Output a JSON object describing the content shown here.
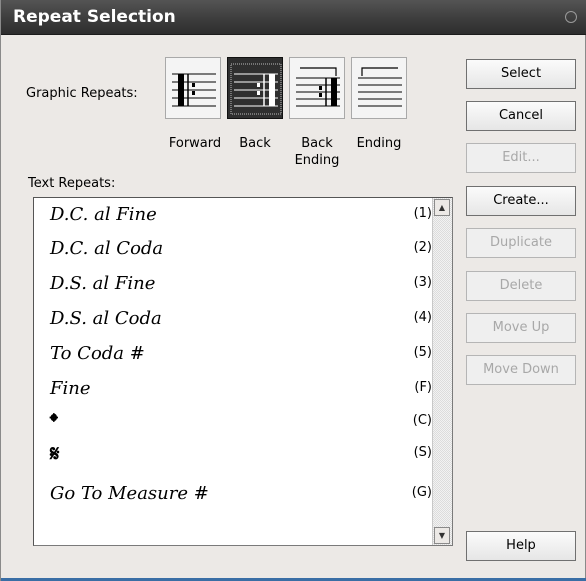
{
  "window": {
    "title": "Repeat Selection"
  },
  "graphic_repeats": {
    "label": "Graphic Repeats:",
    "items": [
      {
        "caption": "Forward",
        "icon": "forward-repeat-barline-icon",
        "selected": false
      },
      {
        "caption": "Back",
        "icon": "back-repeat-barline-icon",
        "selected": true
      },
      {
        "caption": "Back\nEnding",
        "icon": "back-ending-bracket-icon",
        "selected": false
      },
      {
        "caption": "Ending",
        "icon": "ending-bracket-icon",
        "selected": false
      }
    ]
  },
  "text_repeats": {
    "label": "Text Repeats:",
    "items": [
      {
        "text": "D.C. al Fine",
        "key": "(1)"
      },
      {
        "text": "D.C. al Coda",
        "key": "(2)"
      },
      {
        "text": "D.S. al Fine",
        "key": "(3)"
      },
      {
        "text": "D.S. al Coda",
        "key": "(4)"
      },
      {
        "text": "To Coda #",
        "key": "(5)"
      },
      {
        "text": "Fine",
        "key": "(F)"
      },
      {
        "text": "𝄌",
        "key": "(C)",
        "icon": "coda-symbol-icon"
      },
      {
        "text": "𝄋",
        "key": "(S)",
        "icon": "segno-symbol-icon"
      },
      {
        "text": "Go To Measure #",
        "key": "(G)"
      }
    ]
  },
  "buttons": {
    "select": "Select",
    "cancel": "Cancel",
    "edit": "Edit...",
    "create": "Create...",
    "duplicate": "Duplicate",
    "delete": "Delete",
    "move_up": "Move Up",
    "move_down": "Move Down",
    "help": "Help"
  }
}
